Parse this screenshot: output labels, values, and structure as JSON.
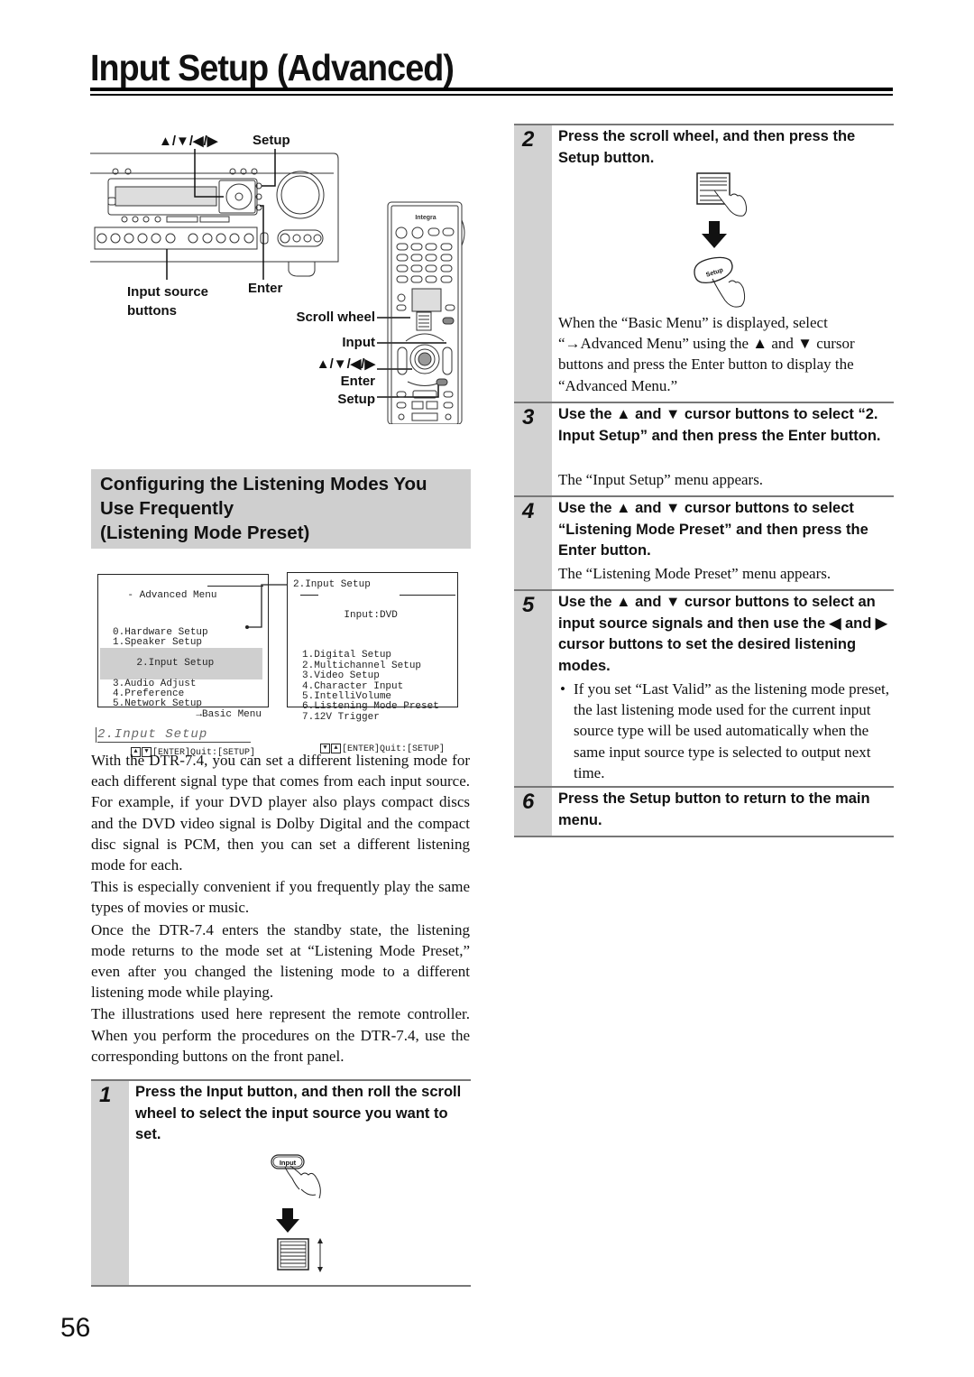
{
  "page": {
    "title": "Input Setup (Advanced)",
    "page_number": "56"
  },
  "illustration": {
    "receiver_labels": {
      "cursor": "▲/▼/◀/▶",
      "setup": "Setup",
      "input_source_line1": "Input source",
      "input_source_line2": "buttons",
      "enter": "Enter"
    },
    "remote_labels": {
      "brand": "Integra",
      "scroll_wheel": "Scroll wheel",
      "input": "Input",
      "cursor": "▲/▼/◀/▶",
      "enter": "Enter",
      "setup": "Setup"
    }
  },
  "section": {
    "heading_lines": [
      "Configuring the Listening Modes You",
      "Use Frequently",
      "(Listening Mode Preset)"
    ]
  },
  "osd": {
    "advanced_menu": {
      "title": "- Advanced Menu",
      "items": [
        "0.Hardware Setup",
        "1.Speaker Setup",
        "2.Input Setup",
        "3.Audio Adjust",
        "4.Preference",
        "5.Network Setup"
      ],
      "selected_index": 2,
      "basic_link": "→Basic Menu",
      "footer": "[ENTER]Quit:[SETUP]"
    },
    "input_setup_menu": {
      "title": "2.Input Setup",
      "subtitle": "Input:DVD",
      "items": [
        "1.Digital Setup",
        "2.Multichannel Setup",
        "3.Video Setup",
        "4.Character Input",
        "5.IntelliVolume",
        "6.Listening Mode Preset",
        "7.12V Trigger"
      ],
      "footer": "[ENTER]Quit:[SETUP]"
    },
    "display_label": "2.Input Setup"
  },
  "body": {
    "paragraphs": [
      "With the DTR-7.4, you can set a different listening mode for each different signal type that comes from each input source. For example, if your DVD player also plays compact discs and the DVD video signal is Dolby Digital and the compact disc signal is PCM, then you can set a different listening mode for each.",
      "This is especially convenient if you frequently play the same types of movies or music.",
      "Once the DTR-7.4 enters the standby state, the listening mode returns to the mode set at “Listening Mode Preset,” even after you changed the listening mode to a different listening mode while playing.",
      "The illustrations used here represent the remote controller. When you perform the procedures on the DTR-7.4, use the corresponding buttons on the front panel."
    ]
  },
  "steps": [
    {
      "number": "1",
      "heading": "Press the Input button, and then roll the scroll wheel to select the input source you want to set.",
      "button_label": "Input"
    },
    {
      "number": "2",
      "heading": "Press the scroll wheel, and then press the Setup button.",
      "button_label": "Setup",
      "description": "When the “Basic Menu” is displayed, select “→Advanced Menu” using the ▲ and ▼ cursor buttons and press the Enter button to display the “Advanced Menu.”"
    },
    {
      "number": "3",
      "heading": "Use the ▲ and ▼ cursor buttons to select “2. Input Setup” and then press the Enter button.",
      "description": "The “Input Setup” menu appears."
    },
    {
      "number": "4",
      "heading": "Use the ▲ and ▼ cursor buttons to select “Listening Mode Preset” and then press the Enter button.",
      "description": "The “Listening Mode Preset” menu appears."
    },
    {
      "number": "5",
      "heading": "Use the ▲ and ▼ cursor buttons to select an input source signals and then use the ◀ and ▶ cursor buttons to set the desired listening modes.",
      "bullet": "If you set “Last Valid” as the listening mode preset, the last listening mode used for the current input source type will be used automatically when the same input source type is selected to output next time."
    },
    {
      "number": "6",
      "heading": "Press the Setup button to return to the main menu."
    }
  ]
}
